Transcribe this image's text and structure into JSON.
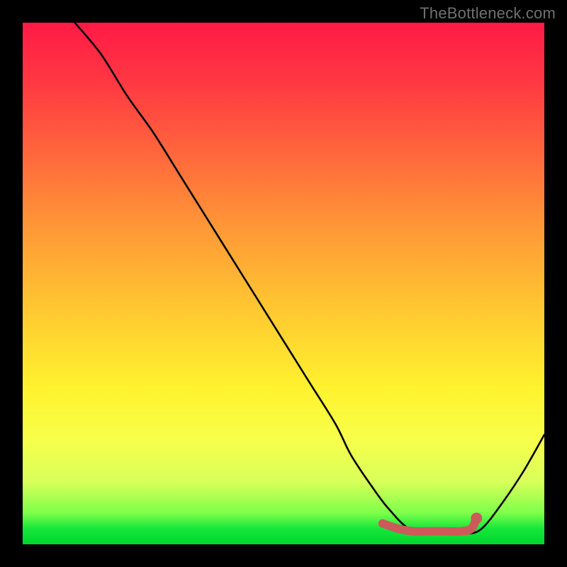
{
  "watermark": "TheBottleneck.com",
  "chart_data": {
    "type": "line",
    "title": "",
    "xlabel": "",
    "ylabel": "",
    "xlim": [
      0,
      100
    ],
    "ylim": [
      0,
      100
    ],
    "series": [
      {
        "name": "curve",
        "x": [
          10,
          15,
          20,
          25,
          30,
          35,
          40,
          45,
          50,
          55,
          60,
          63,
          67,
          70,
          74,
          78,
          82,
          85,
          88,
          92,
          96,
          100
        ],
        "values": [
          100,
          94,
          86,
          79,
          71,
          63,
          55,
          47,
          39,
          31,
          23,
          17,
          11,
          7,
          3,
          2,
          2,
          2,
          3,
          8,
          14,
          21
        ]
      }
    ],
    "highlight": {
      "name": "bottleneck-range",
      "color": "#cc5a5a",
      "x": [
        69,
        72,
        75,
        78,
        81,
        84,
        86,
        87
      ],
      "values": [
        4,
        3,
        2.5,
        2.5,
        2.5,
        2.5,
        3,
        5
      ]
    },
    "gradient_stops": [
      {
        "pos": 0,
        "color": "#ff1a46"
      },
      {
        "pos": 26,
        "color": "#ff6a3c"
      },
      {
        "pos": 55,
        "color": "#ffc831"
      },
      {
        "pos": 80,
        "color": "#f7ff4a"
      },
      {
        "pos": 94,
        "color": "#7dff4a"
      },
      {
        "pos": 100,
        "color": "#00d62f"
      }
    ]
  }
}
